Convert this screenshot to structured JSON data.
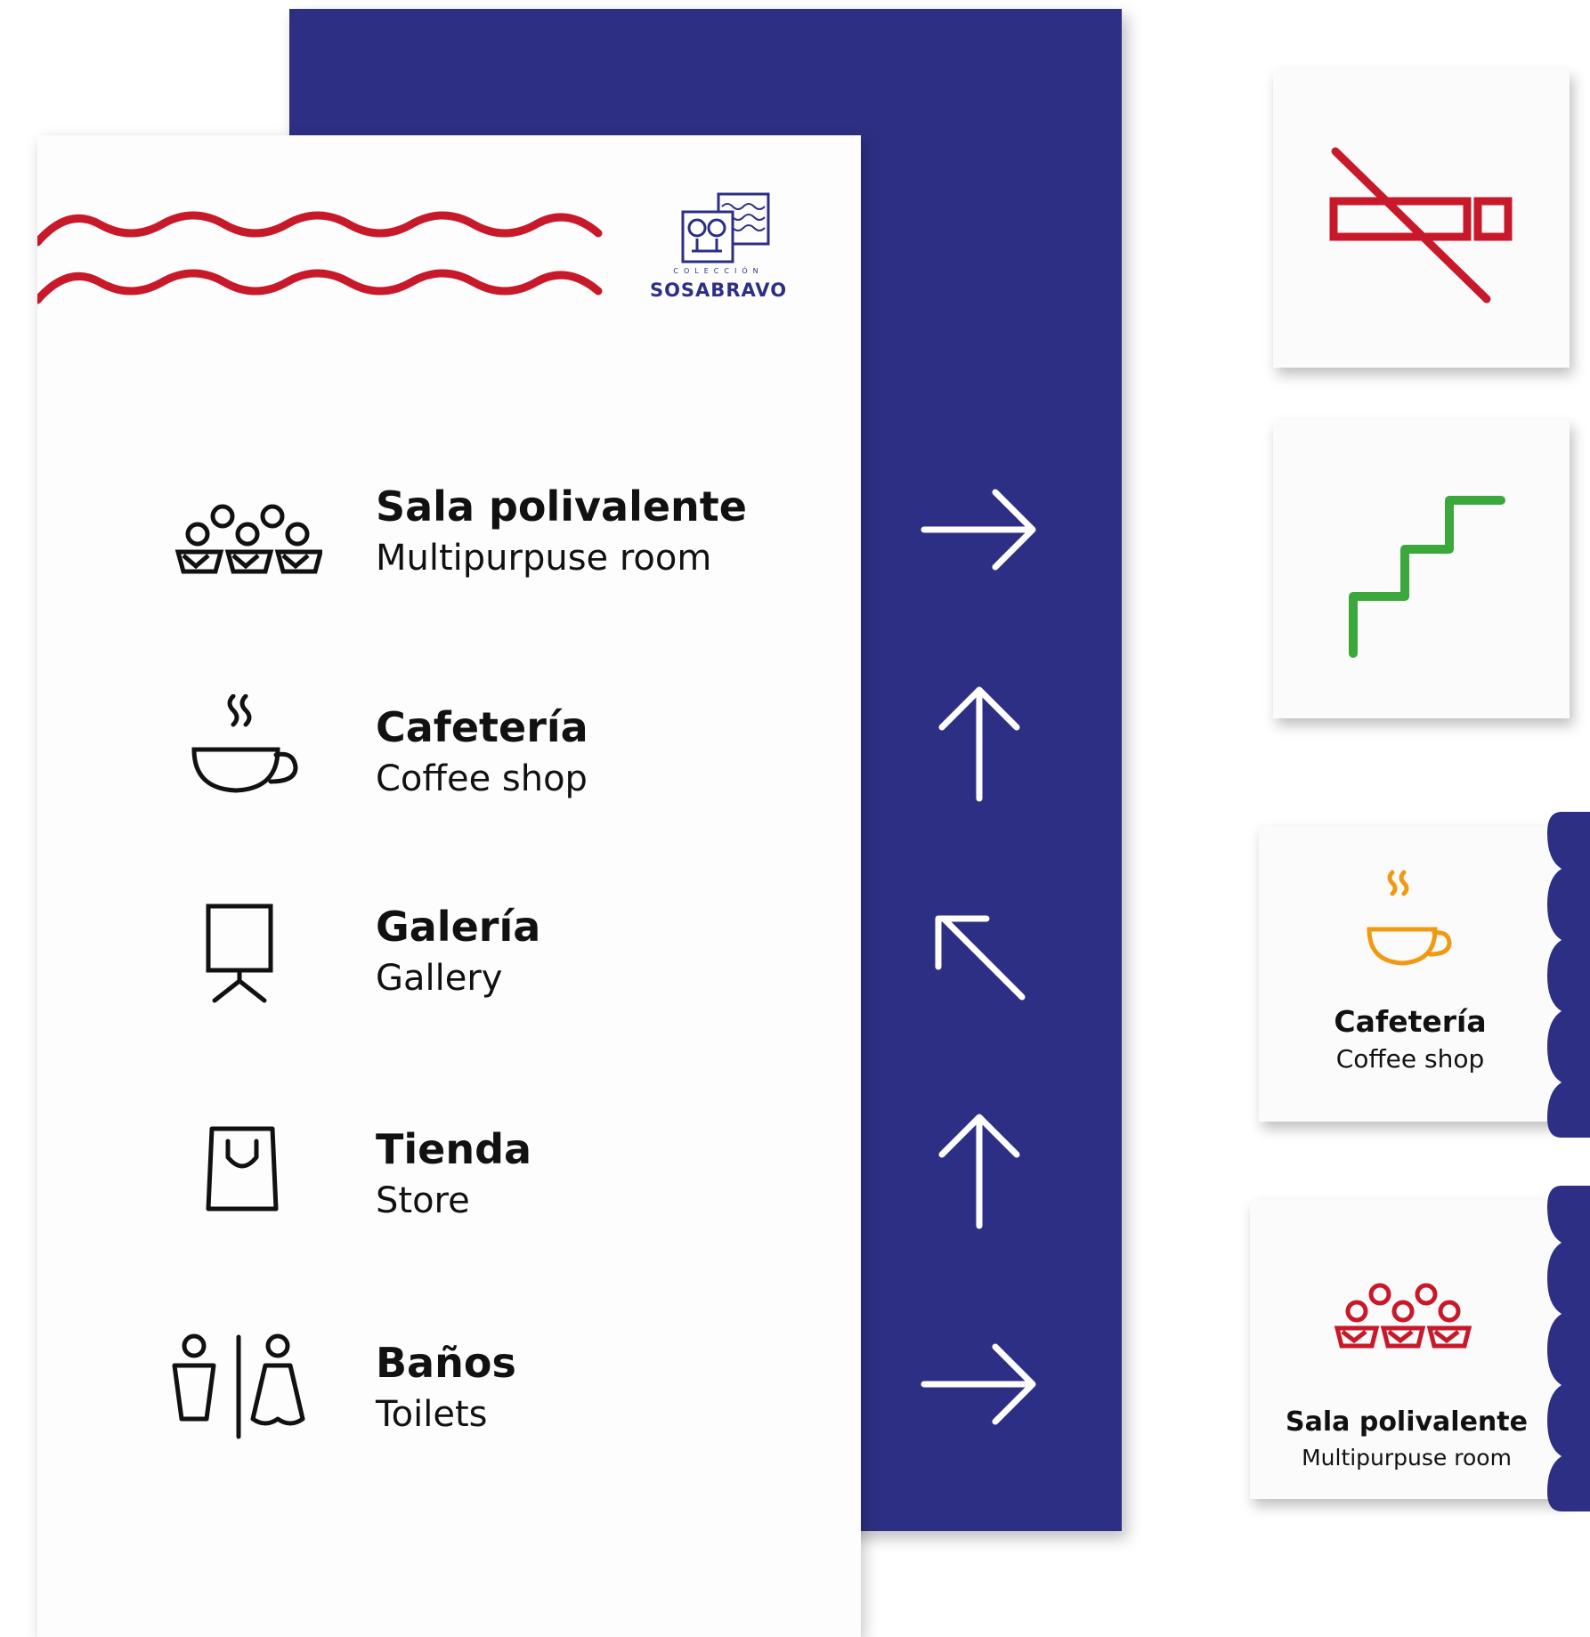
{
  "colors": {
    "navy": "#2d2f84",
    "red": "#c8192b",
    "green": "#3aa83a",
    "orange": "#f09a12",
    "ink": "#111111"
  },
  "logo": {
    "small": "COLECCIÓN",
    "name": "SOSABRAVO"
  },
  "main_sign": {
    "rows": [
      {
        "title": "Sala polivalente",
        "subtitle": "Multipurpuse room",
        "icon": "audience-icon",
        "arrow": "arrow-right-icon"
      },
      {
        "title": "Cafetería",
        "subtitle": "Coffee shop",
        "icon": "coffee-cup-icon",
        "arrow": "arrow-up-icon"
      },
      {
        "title": "Galería",
        "subtitle": "Gallery",
        "icon": "easel-icon",
        "arrow": "arrow-up-left-icon"
      },
      {
        "title": "Tienda",
        "subtitle": "Store",
        "icon": "shopping-bag-icon",
        "arrow": "arrow-up-icon"
      },
      {
        "title": "Baños",
        "subtitle": "Toilets",
        "icon": "restroom-icon",
        "arrow": "arrow-right-icon"
      }
    ]
  },
  "tiles": {
    "no_smoking": {
      "icon": "no-smoking-icon"
    },
    "stairs": {
      "icon": "stairs-icon"
    },
    "cafeteria": {
      "title": "Cafetería",
      "subtitle": "Coffee shop",
      "icon": "coffee-cup-icon"
    },
    "sala": {
      "title": "Sala polivalente",
      "subtitle": "Multipurpuse room",
      "icon": "audience-icon"
    }
  }
}
